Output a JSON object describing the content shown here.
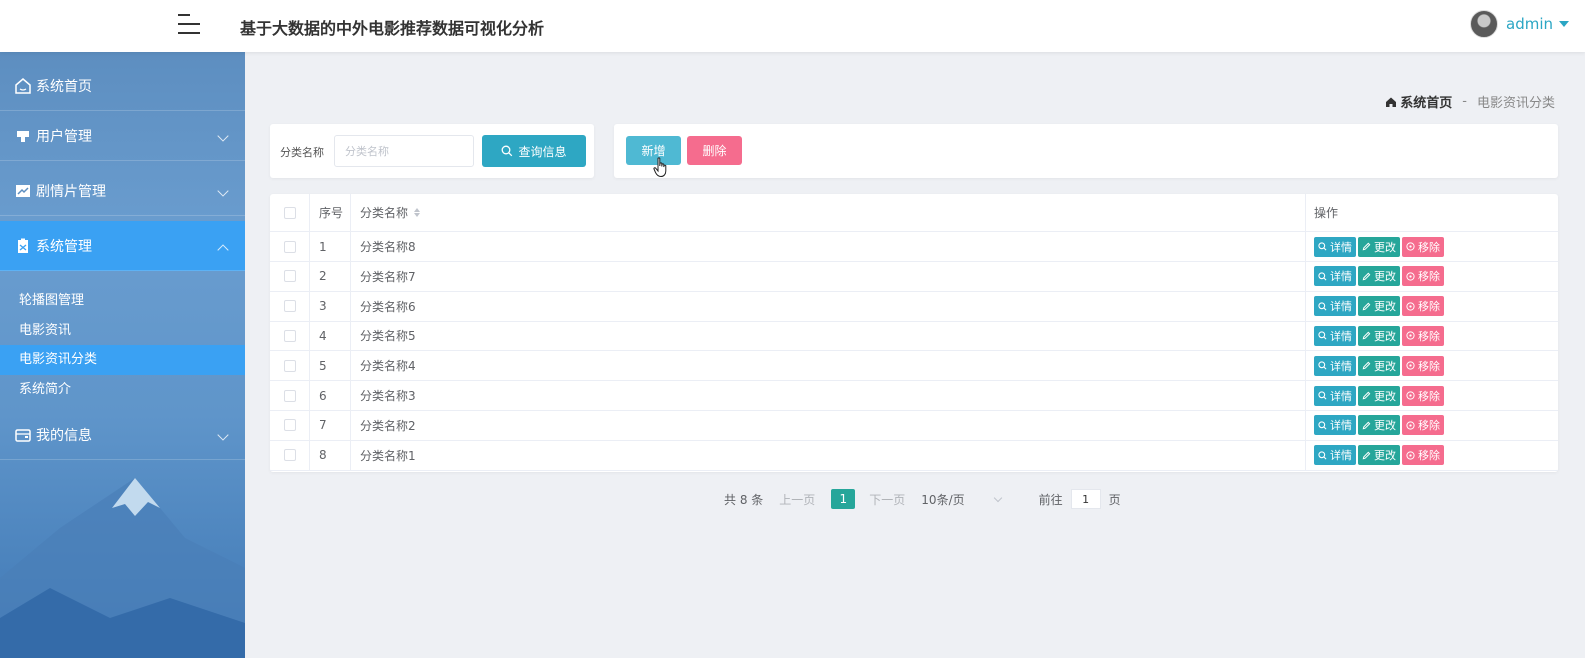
{
  "header": {
    "title": "基于大数据的中外电影推荐数据可视化分析",
    "user_name": "admin"
  },
  "sidebar": {
    "items": [
      {
        "label": "系统首页",
        "icon": "home-icon"
      },
      {
        "label": "用户管理",
        "icon": "user-icon"
      },
      {
        "label": "剧情片管理",
        "icon": "chart-line-icon"
      },
      {
        "label": "系统管理",
        "icon": "clipboard-icon"
      },
      {
        "label": "我的信息",
        "icon": "wallet-icon"
      }
    ],
    "sub_items": [
      {
        "label": "轮播图管理"
      },
      {
        "label": "电影资讯"
      },
      {
        "label": "电影资讯分类"
      },
      {
        "label": "系统简介"
      }
    ]
  },
  "breadcrumb": {
    "home": "系统首页",
    "separator": "-",
    "current": "电影资讯分类"
  },
  "search": {
    "label": "分类名称",
    "placeholder": "分类名称",
    "button": "查询信息"
  },
  "actions": {
    "add": "新增",
    "delete": "删除"
  },
  "table": {
    "headers": {
      "index": "序号",
      "name": "分类名称",
      "ops": "操作"
    },
    "rows": [
      {
        "index": "1",
        "name": "分类名称8"
      },
      {
        "index": "2",
        "name": "分类名称7"
      },
      {
        "index": "3",
        "name": "分类名称6"
      },
      {
        "index": "4",
        "name": "分类名称5"
      },
      {
        "index": "5",
        "name": "分类名称4"
      },
      {
        "index": "6",
        "name": "分类名称3"
      },
      {
        "index": "7",
        "name": "分类名称2"
      },
      {
        "index": "8",
        "name": "分类名称1"
      }
    ],
    "row_actions": {
      "detail": "详情",
      "edit": "更改",
      "remove": "移除"
    }
  },
  "pagination": {
    "total": "共 8 条",
    "prev": "上一页",
    "page": "1",
    "next": "下一页",
    "page_size": "10条/页",
    "goto": "前往",
    "goto_value": "1",
    "page_suffix": "页"
  },
  "colors": {
    "primary": "#2ea7c3",
    "edit": "#26a69a",
    "danger": "#f56c8e",
    "active_nav": "#3aa1f3"
  }
}
